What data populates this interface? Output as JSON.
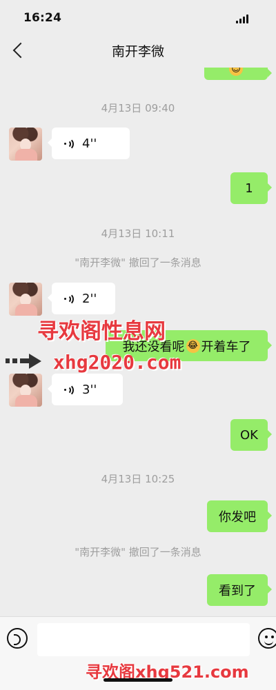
{
  "status_bar": {
    "time": "16:24"
  },
  "header": {
    "title": "南开李微"
  },
  "messages": {
    "time1": "4月13日 09:40",
    "voice1": "4''",
    "sent1": "1",
    "time2": "4月13日 10:11",
    "recall1": "\"南开李微\" 撤回了一条消息",
    "voice2": "2''",
    "sent2_before": "我还没看呢",
    "sent2_emoji": "😂",
    "sent2_after": "开着车了",
    "voice3": "3''",
    "sent3": "OK",
    "time3": "4月13日 10:25",
    "sent4": "你发吧",
    "recall2": "\"南开李微\" 撤回了一条消息",
    "sent5": "看到了"
  },
  "watermarks": {
    "title": "寻欢阁性息网",
    "domain1": "xhg2020.com",
    "bottom": "寻欢阁xhg521.com"
  },
  "colors": {
    "green_bubble": "#95ec69",
    "background": "#ededed",
    "watermark": "#e7393f"
  },
  "icons": [
    "back-icon",
    "voice-icon",
    "emoji-icon",
    "signal-icon"
  ]
}
